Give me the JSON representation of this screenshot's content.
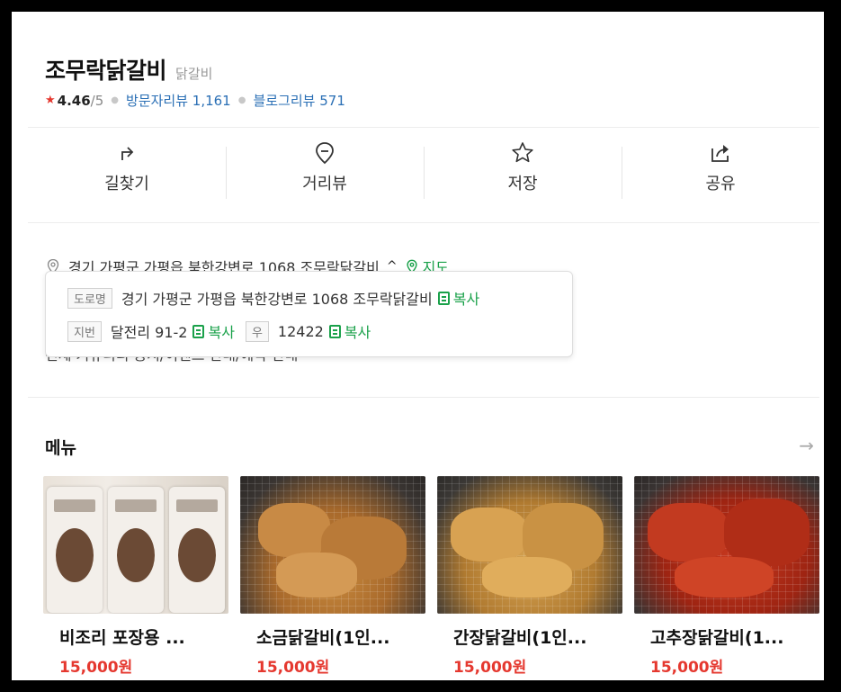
{
  "place": {
    "name": "조무락닭갈비",
    "category": "닭갈비",
    "rating": "4.46",
    "rating_max": "/5",
    "visitor_reviews": "방문자리뷰 1,161",
    "blog_reviews": "블로그리뷰 571"
  },
  "actions": [
    {
      "label": "길찾기",
      "icon": "directions-icon"
    },
    {
      "label": "거리뷰",
      "icon": "street-view-icon"
    },
    {
      "label": "저장",
      "icon": "star-icon"
    },
    {
      "label": "공유",
      "icon": "share-icon"
    }
  ],
  "address": {
    "text": "경기 가평군 가평읍 북한강변로 1068 조무락닭갈비",
    "map_label": "지도",
    "hidden_row": "전체 커뮤니티 공지/이벤트 안내/예약 안내"
  },
  "address_popup": {
    "road_tag": "도로명",
    "road_address": "경기 가평군 가평읍 북한강변로 1068 조무락닭갈비",
    "lot_tag": "지번",
    "lot_address": "달전리 91-2",
    "zip_tag": "우",
    "zip_code": "12422",
    "copy_label": "복사"
  },
  "menu": {
    "title": "메뉴",
    "items": [
      {
        "name": "비조리 포장용 ...",
        "price": "15,000원"
      },
      {
        "name": "소금닭갈비(1인...",
        "price": "15,000원"
      },
      {
        "name": "간장닭갈비(1인...",
        "price": "15,000원"
      },
      {
        "name": "고추장닭갈비(1...",
        "price": "15,000원"
      }
    ]
  },
  "colors": {
    "accent_green": "#1aa14a",
    "price_red": "#e5382f",
    "review_blue": "#2a6fb5"
  }
}
